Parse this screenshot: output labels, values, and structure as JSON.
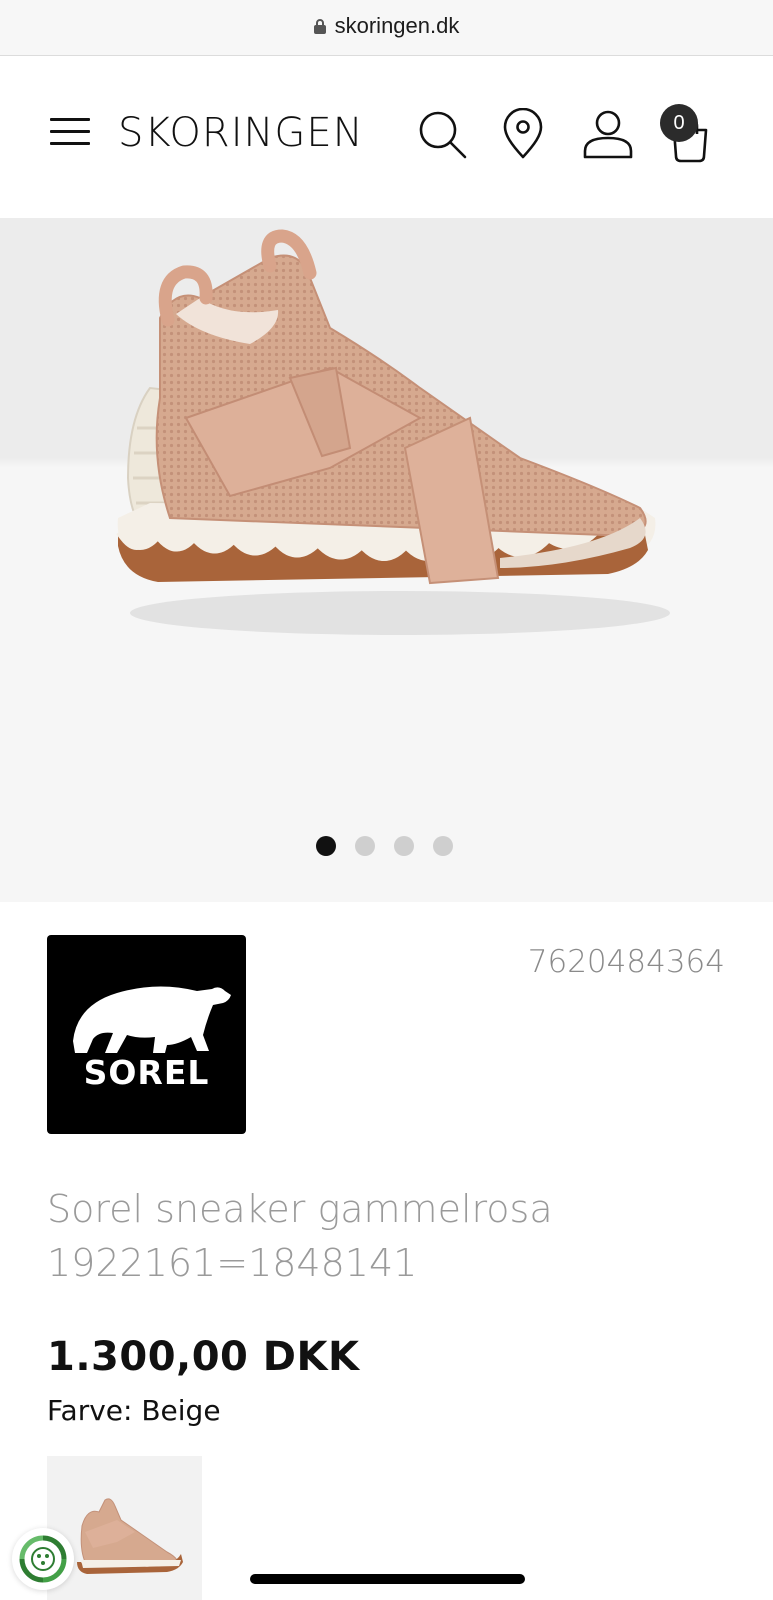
{
  "browser": {
    "url": "skoringen.dk"
  },
  "header": {
    "logo": "SKORINGEN",
    "icons": [
      "menu-icon",
      "search-icon",
      "store-locator-icon",
      "account-icon",
      "cart-icon"
    ],
    "cart_count": "0"
  },
  "gallery": {
    "image_count": 4,
    "active_index": 0
  },
  "product": {
    "brand_logo_text": "SOREL",
    "article_number": "7620484364",
    "name_line1": "Sorel sneaker gammelrosa",
    "name_line2": "1922161=1848141",
    "price": "1.300,00 DKK",
    "color_label": "Farve: Beige"
  },
  "colors": {
    "text": "#111111",
    "muted": "#9a9a9a",
    "shoe": "#d9ad92",
    "sole": "#f1ece4",
    "gum": "#a9643a"
  }
}
